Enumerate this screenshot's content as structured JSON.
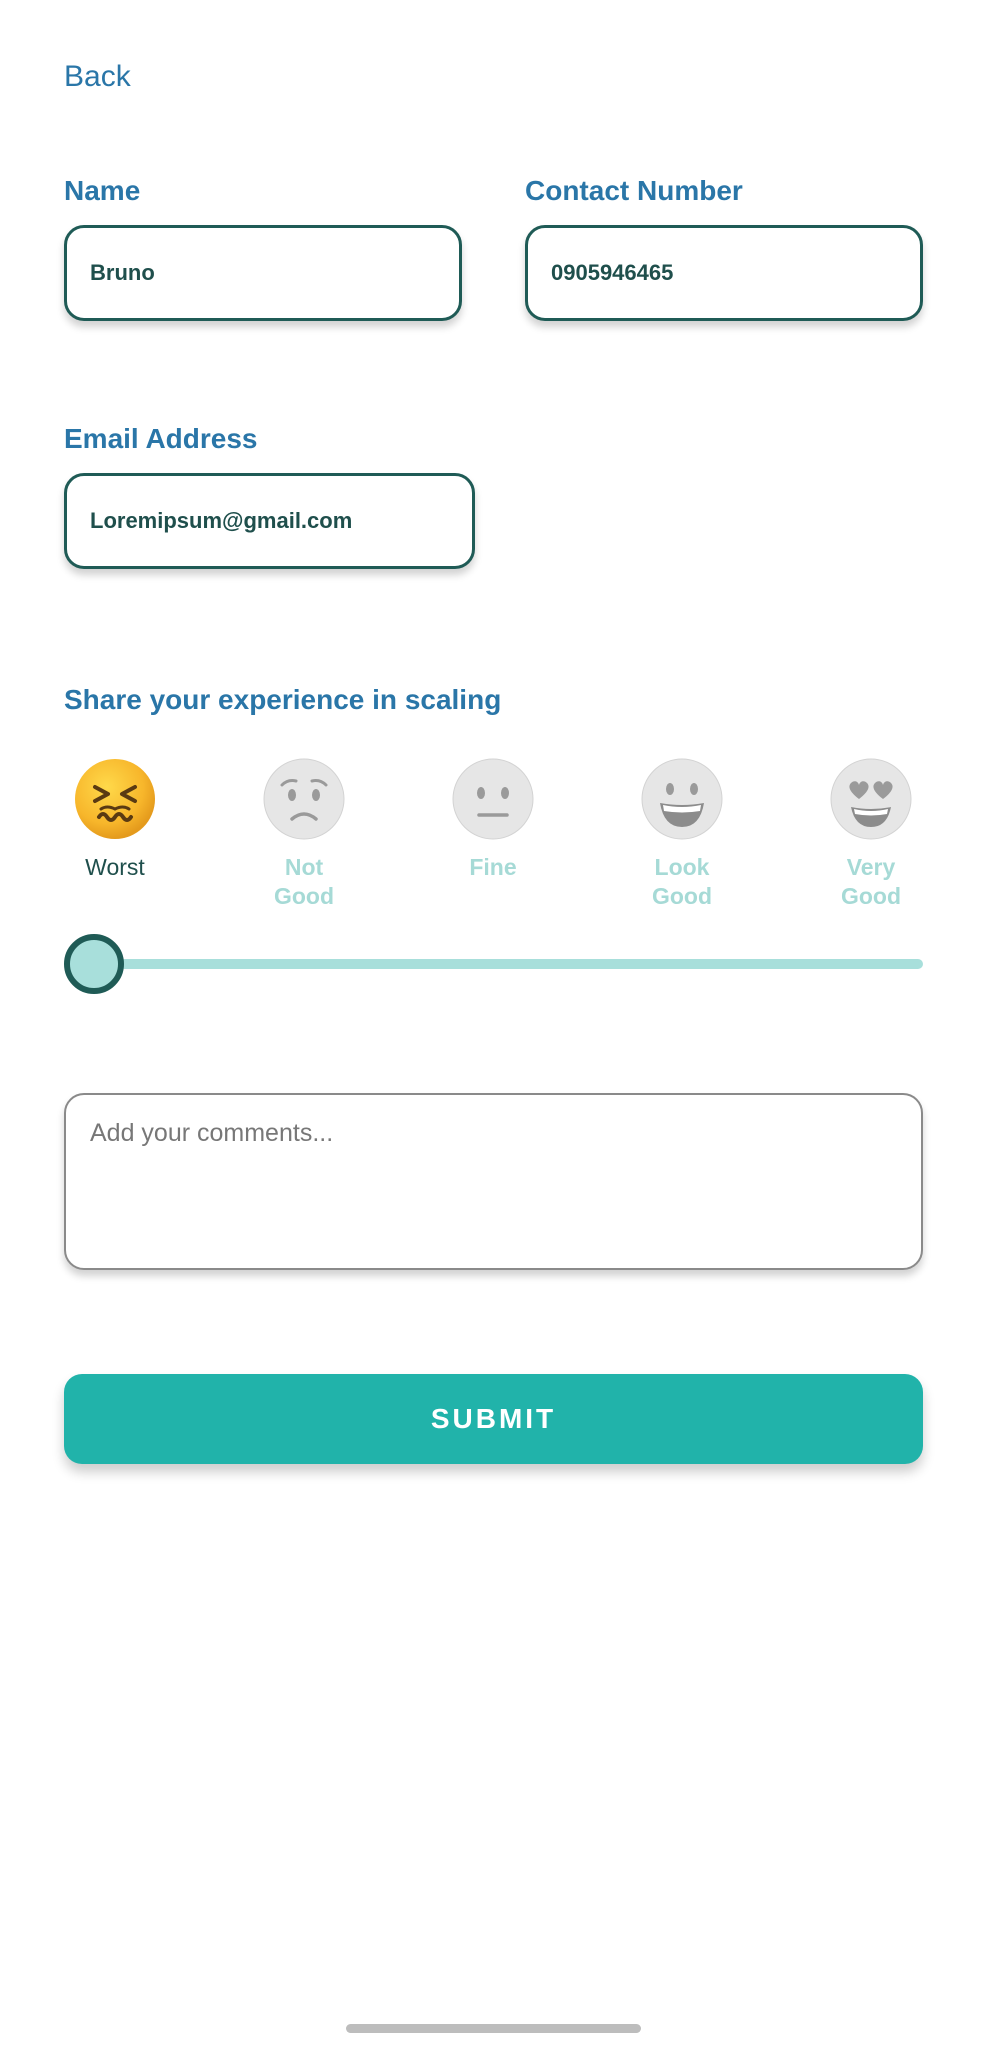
{
  "nav": {
    "back_label": "Back"
  },
  "form": {
    "name_label": "Name",
    "name_value": "Bruno",
    "contact_label": "Contact Number",
    "contact_value": "0905946465",
    "email_label": "Email Address",
    "email_value": "Loremipsum@gmail.com"
  },
  "rating": {
    "heading": "Share your experience in scaling",
    "selected_index": 0,
    "options": [
      {
        "label_line1": "Worst",
        "label_line2": "",
        "icon": "confounded-face-icon",
        "active": true
      },
      {
        "label_line1": "Not",
        "label_line2": "Good",
        "icon": "sad-face-icon",
        "active": false
      },
      {
        "label_line1": "Fine",
        "label_line2": "",
        "icon": "neutral-face-icon",
        "active": false
      },
      {
        "label_line1": "Look",
        "label_line2": "Good",
        "icon": "grinning-face-icon",
        "active": false
      },
      {
        "label_line1": "Very",
        "label_line2": "Good",
        "icon": "heart-eyes-face-icon",
        "active": false
      }
    ],
    "slider_value": 0
  },
  "comments": {
    "placeholder": "Add your comments..."
  },
  "actions": {
    "submit_label": "SUBMIT"
  },
  "colors": {
    "primary": "#21b3aa",
    "label": "#2a76a8",
    "border": "#1f5b56",
    "inactive": "#a6dad6"
  }
}
